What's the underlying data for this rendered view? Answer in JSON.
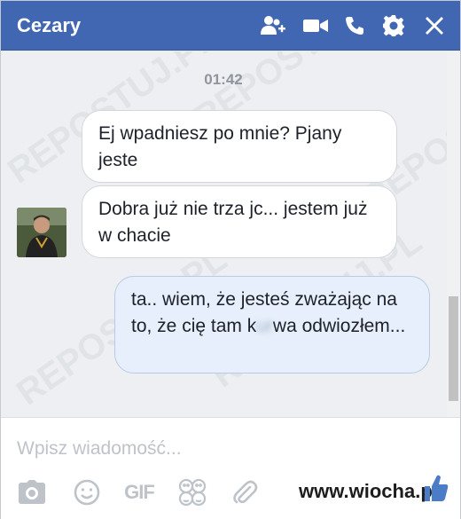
{
  "chat": {
    "title": "Cezary",
    "timestamp": "01:42"
  },
  "header_icons": [
    "add-person-icon",
    "video-camera-icon",
    "phone-icon",
    "gear-icon",
    "close-icon"
  ],
  "messages": [
    {
      "sender": "Cezary",
      "direction": "in",
      "text": "Ej wpadniesz po mnie? Pjany jeste"
    },
    {
      "sender": "Cezary",
      "direction": "in",
      "text": "Dobra już nie trza jc... jestem już w chacie"
    },
    {
      "sender": "me",
      "direction": "out",
      "text_before": "ta.. wiem, że jesteś zważając na to, że cię tam k",
      "censored": "ur",
      "text_after": "wa odwiozłem..."
    }
  ],
  "composer": {
    "placeholder": "Wpisz wiadomość...",
    "gif_label": "GIF"
  },
  "composer_icons": [
    "camera-icon",
    "smiley-icon",
    "gif-icon",
    "stickers-icon",
    "paperclip-icon",
    "thumbs-up-icon"
  ],
  "watermarks": {
    "diagonal": "REPOSTUJ.PL",
    "corner": "www.wiocha.pl"
  },
  "colors": {
    "header": "#4267b2",
    "outgoing_bubble": "#e6effb",
    "incoming_bubble": "#ffffff",
    "icon_gray": "#bec3c9"
  }
}
